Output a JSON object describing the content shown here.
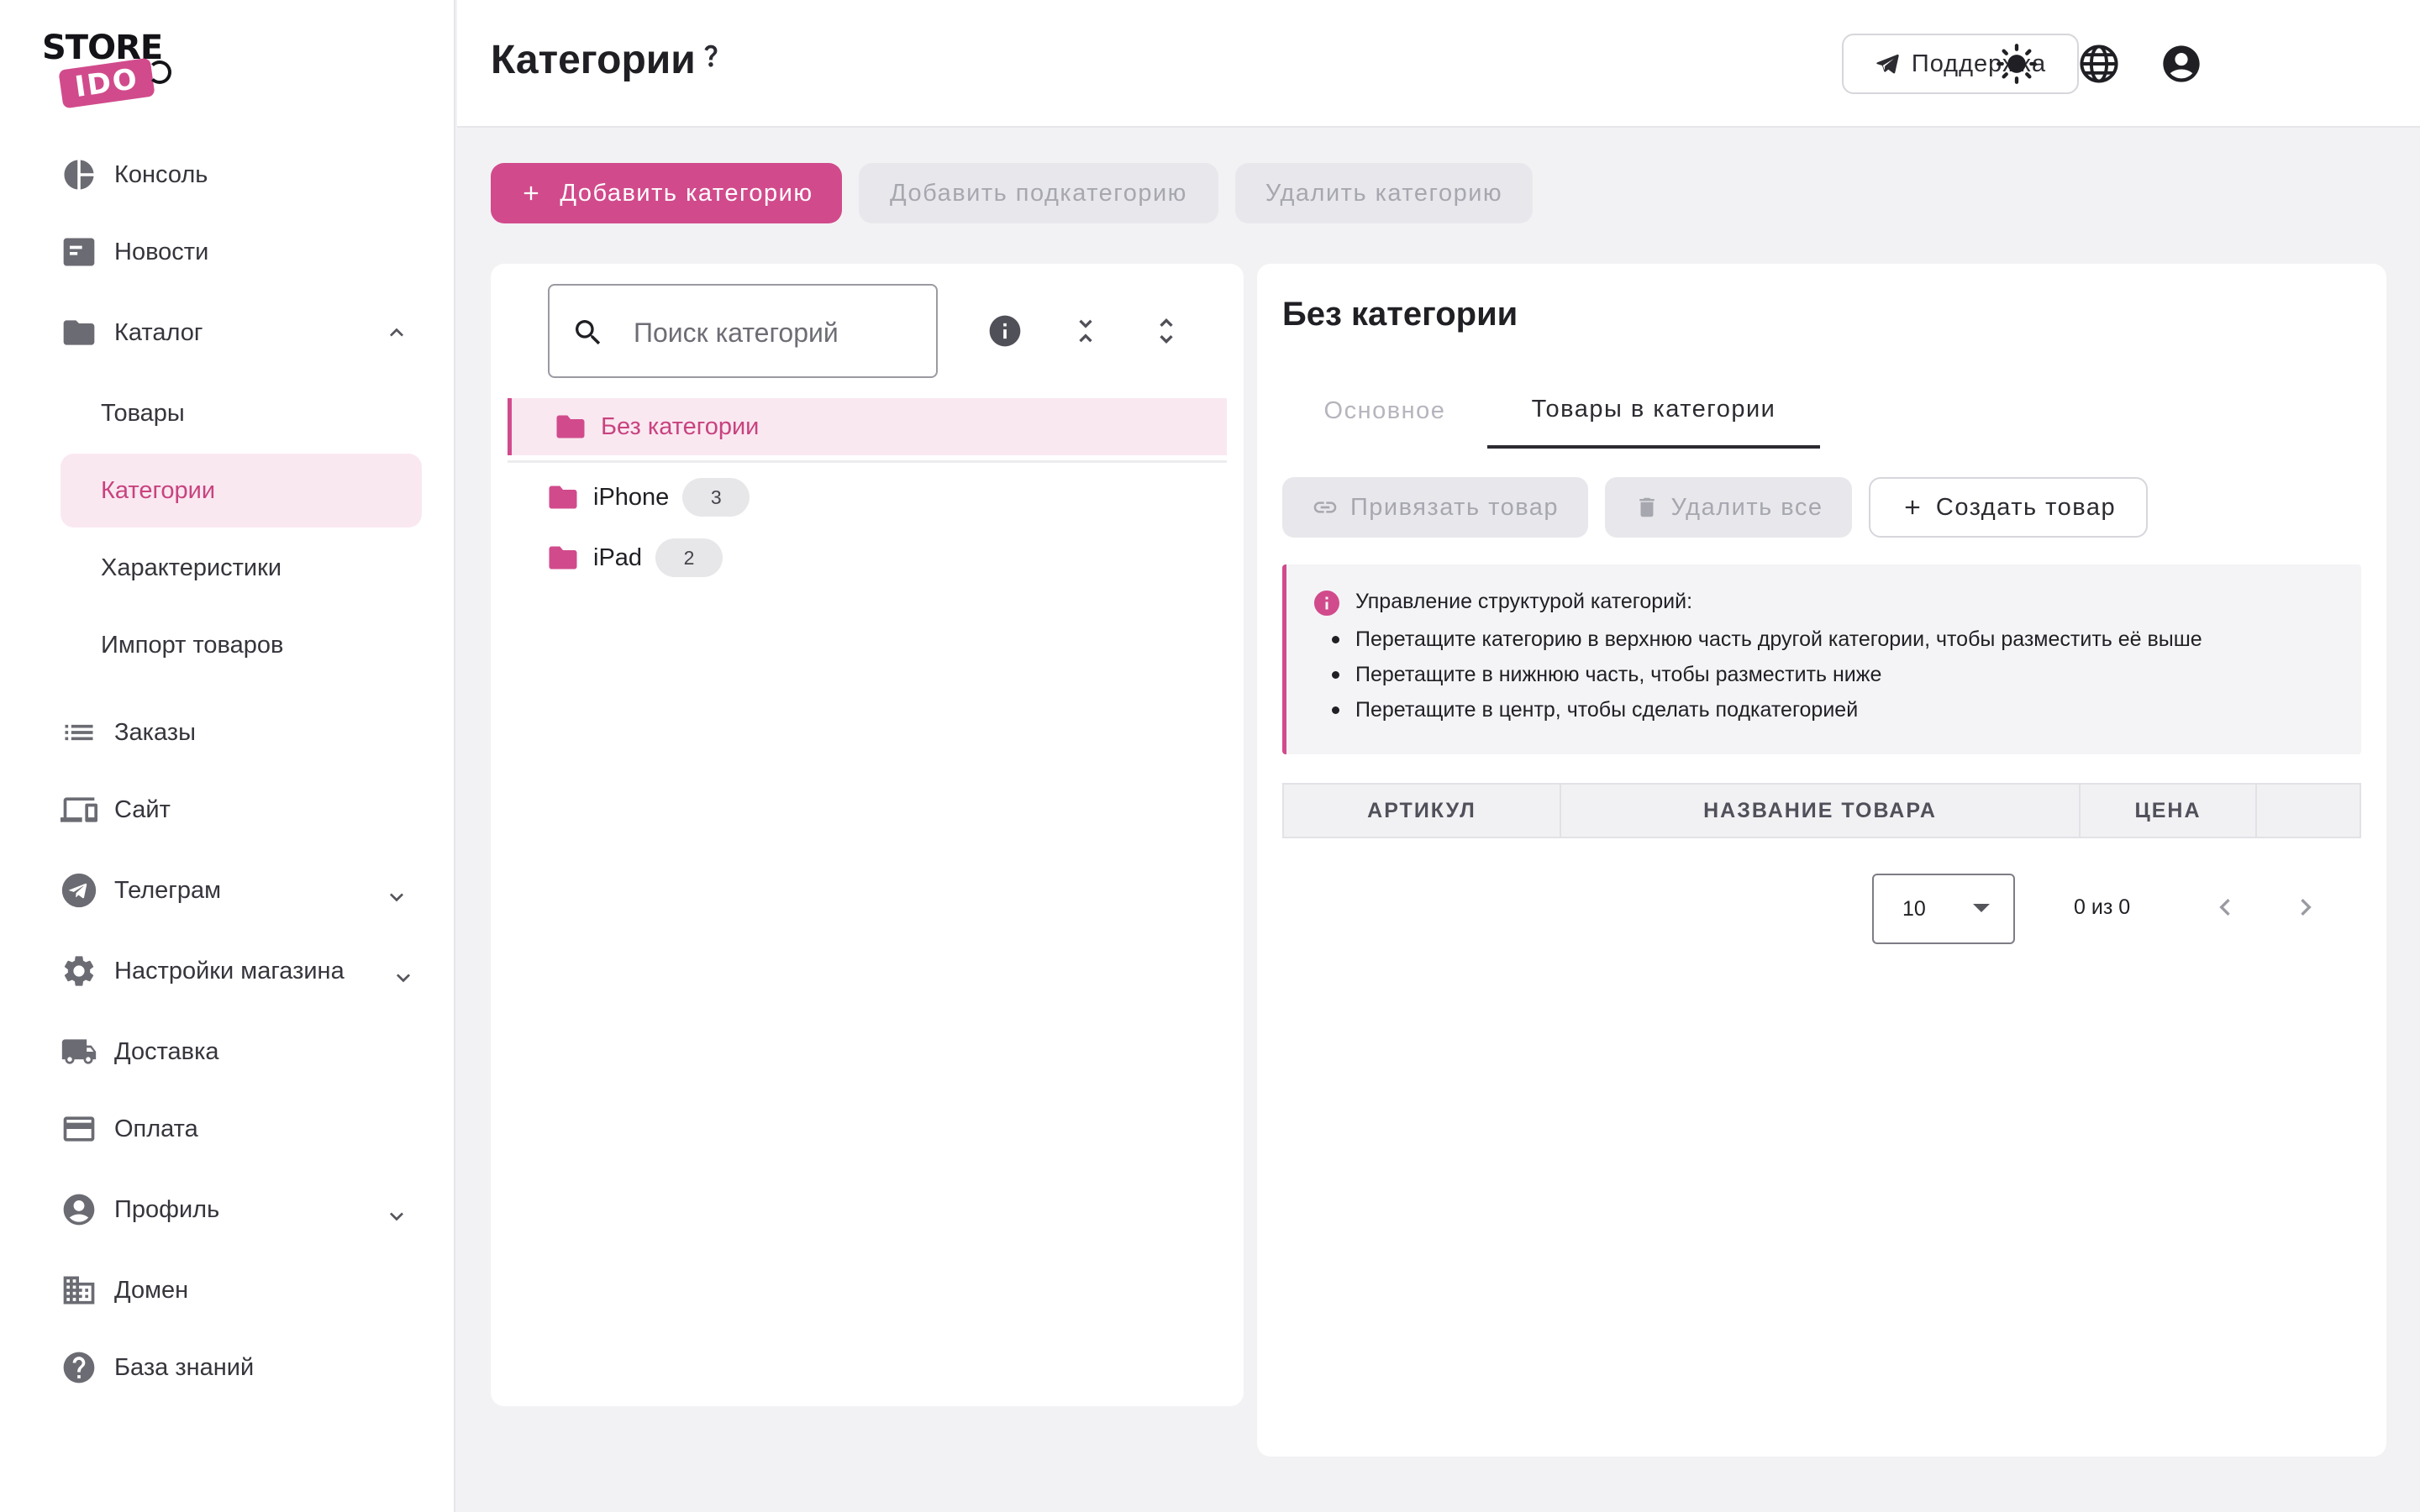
{
  "brand": {
    "line1": "STORE",
    "line2": "IDO",
    "accent": "#d14b8c"
  },
  "sidebar": {
    "items": [
      {
        "label": "Консоль",
        "icon": "pie-chart-icon"
      },
      {
        "label": "Новости",
        "icon": "newspaper-icon"
      },
      {
        "label": "Каталог",
        "icon": "folder-icon",
        "expanded": true,
        "children": [
          "Товары",
          "Категории",
          "Характеристики",
          "Импорт товаров"
        ],
        "active_child": "Категории"
      },
      {
        "label": "Заказы",
        "icon": "list-icon"
      },
      {
        "label": "Сайт",
        "icon": "devices-icon"
      },
      {
        "label": "Телеграм",
        "icon": "telegram-icon",
        "expanded": false
      },
      {
        "label": "Настройки магазина",
        "icon": "gear-icon",
        "expanded": false
      },
      {
        "label": "Доставка",
        "icon": "truck-icon"
      },
      {
        "label": "Оплата",
        "icon": "credit-card-icon"
      },
      {
        "label": "Профиль",
        "icon": "account-icon",
        "expanded": false
      },
      {
        "label": "Домен",
        "icon": "domain-icon"
      },
      {
        "label": "База знаний",
        "icon": "help-icon"
      }
    ]
  },
  "header": {
    "title": "Категории",
    "support_label": "Поддержка",
    "icons": [
      "theme-sun-icon",
      "language-globe-icon",
      "account-icon"
    ]
  },
  "toolbar": {
    "add_category": "Добавить категорию",
    "add_subcategory": "Добавить подкатегорию",
    "delete_category": "Удалить категорию"
  },
  "tree": {
    "search_placeholder": "Поиск категорий",
    "selected": {
      "label": "Без категории"
    },
    "items": [
      {
        "label": "iPhone",
        "count": "3"
      },
      {
        "label": "iPad",
        "count": "2"
      }
    ]
  },
  "detail": {
    "title": "Без категории",
    "tabs": [
      "Основное",
      "Товары в категории"
    ],
    "active_tab": "Товары в категории",
    "actions": {
      "link": "Привязать товар",
      "delete_all": "Удалить все",
      "create": "Создать товар"
    },
    "info": {
      "title": "Управление структурой категорий:",
      "bullets": [
        "Перетащите категорию в верхнюю часть другой категории, чтобы разместить её выше",
        "Перетащите в нижнюю часть, чтобы разместить ниже",
        "Перетащите в центр, чтобы сделать подкатегорией"
      ]
    },
    "table": {
      "columns": [
        "АРТИКУЛ",
        "НАЗВАНИЕ ТОВАРА",
        "ЦЕНА",
        ""
      ],
      "rows": []
    },
    "pagination": {
      "page_size": "10",
      "range": "0 из 0"
    }
  }
}
